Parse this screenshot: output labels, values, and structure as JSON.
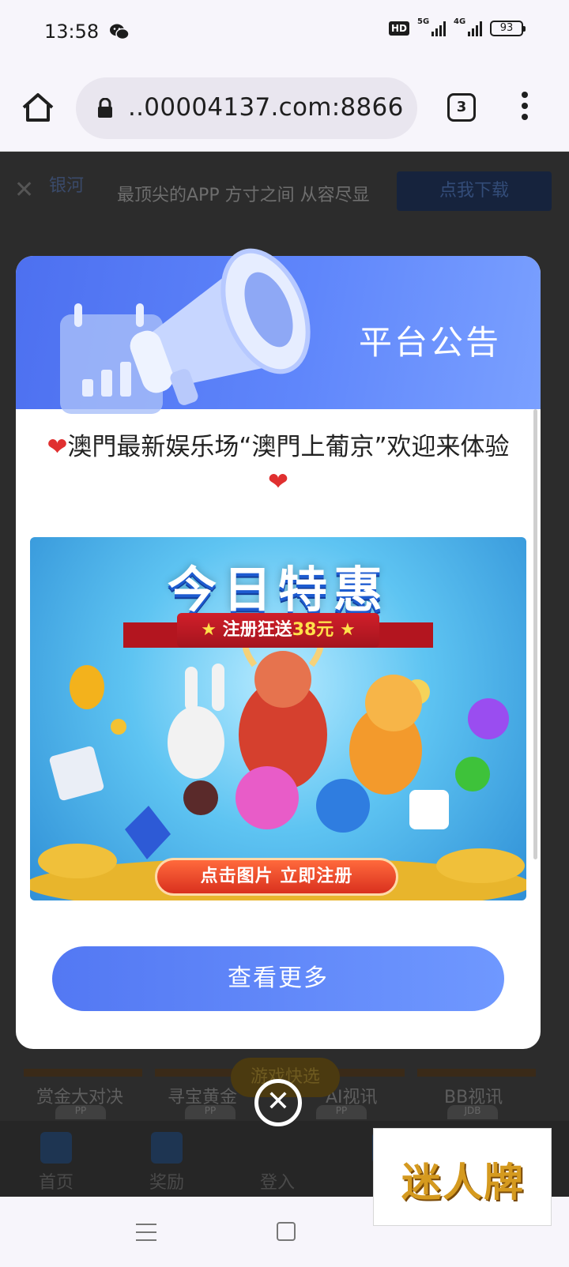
{
  "status_bar": {
    "time": "13:58",
    "signal_1_label": "5G",
    "signal_2_label": "4G",
    "hd_label": "HD",
    "battery": "93"
  },
  "browser": {
    "url": "..00004137.com:8866",
    "tab_count": "3"
  },
  "background_page": {
    "app_banner": {
      "logo": "银河",
      "text": "最顶尖的APP 方寸之间 从容尽显",
      "download_label": "点我下载"
    },
    "games": [
      {
        "label": "赏金大对决",
        "tag": "PP"
      },
      {
        "label": "寻宝黄金",
        "tag": "PP"
      },
      {
        "label": "AI视讯",
        "tag": "PP"
      },
      {
        "label": "BB视讯",
        "tag": "JDB"
      }
    ],
    "quick_game_label": "游戏快选",
    "bottom_nav": [
      {
        "label": "首页"
      },
      {
        "label": "奖励"
      },
      {
        "label": "登入"
      },
      {
        "label": ""
      },
      {
        "label": ""
      }
    ]
  },
  "modal": {
    "title": "平台公告",
    "notice": "澳門最新娱乐场“澳門上葡京”欢迎来体验",
    "promo": {
      "title": "今日特惠",
      "ribbon_prefix": "注册狂送",
      "ribbon_amount": "38元",
      "button_label": "点击图片 立即注册"
    },
    "more_label": "查看更多"
  },
  "watermark": "迷人牌",
  "colors": {
    "accent": "#5378f3",
    "header_start": "#4d70f0",
    "header_end": "#7aa0ff",
    "heart": "#e03030"
  }
}
